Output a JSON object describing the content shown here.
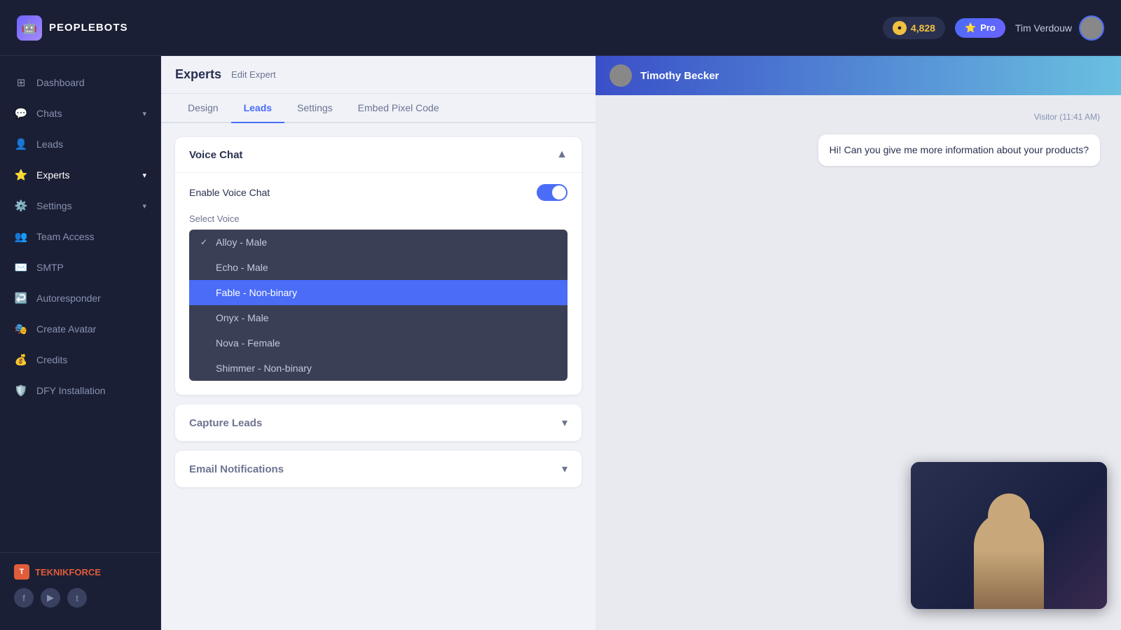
{
  "app": {
    "name": "PEOPLEBOTS",
    "logo_icon": "🤖"
  },
  "topbar": {
    "credits_label": "4,828",
    "pro_label": "Pro",
    "user_name": "Tim Verdouw",
    "coin_symbol": "●"
  },
  "sidebar": {
    "items": [
      {
        "id": "dashboard",
        "label": "Dashboard",
        "icon": "⊞",
        "has_chevron": false
      },
      {
        "id": "chats",
        "label": "Chats",
        "icon": "💬",
        "has_chevron": true
      },
      {
        "id": "leads",
        "label": "Leads",
        "icon": "👤",
        "has_chevron": false
      },
      {
        "id": "experts",
        "label": "Experts",
        "icon": "⭐",
        "has_chevron": true,
        "active": true
      },
      {
        "id": "settings",
        "label": "Settings",
        "icon": "⚙️",
        "has_chevron": true
      },
      {
        "id": "team-access",
        "label": "Team Access",
        "icon": "👥",
        "has_chevron": false
      },
      {
        "id": "smtp",
        "label": "SMTP",
        "icon": "✉️",
        "has_chevron": false
      },
      {
        "id": "autoresponder",
        "label": "Autoresponder",
        "icon": "↩️",
        "has_chevron": false
      },
      {
        "id": "create-avatar",
        "label": "Create Avatar",
        "icon": "🎭",
        "has_chevron": false
      },
      {
        "id": "credits",
        "label": "Credits",
        "icon": "💰",
        "has_chevron": false
      },
      {
        "id": "dfy-installation",
        "label": "DFY Installation",
        "icon": "🛡️",
        "has_chevron": false
      }
    ],
    "footer": {
      "brand_name": "TEKNIKFORCE",
      "social": [
        "f",
        "▶",
        "t"
      ]
    }
  },
  "header": {
    "page_title": "Experts",
    "edit_link": "Edit Expert"
  },
  "tabs": [
    {
      "id": "design",
      "label": "Design"
    },
    {
      "id": "leads",
      "label": "Leads",
      "active": true
    },
    {
      "id": "settings",
      "label": "Settings"
    },
    {
      "id": "embed-pixel-code",
      "label": "Embed Pixel Code"
    }
  ],
  "voice_chat": {
    "section_title": "Voice Chat",
    "enable_label": "Enable Voice Chat",
    "select_voice_label": "Select Voice",
    "toggle_enabled": true,
    "voices": [
      {
        "id": "alloy-male",
        "label": "Alloy - Male",
        "checked": true
      },
      {
        "id": "echo-male",
        "label": "Echo - Male",
        "checked": false
      },
      {
        "id": "fable-nonbinary",
        "label": "Fable - Non-binary",
        "checked": false,
        "highlighted": true
      },
      {
        "id": "onyx-male",
        "label": "Onyx - Male",
        "checked": false
      },
      {
        "id": "nova-female",
        "label": "Nova - Female",
        "checked": false
      },
      {
        "id": "shimmer-nonbinary",
        "label": "Shimmer - Non-binary",
        "checked": false
      }
    ]
  },
  "capture_leads": {
    "section_title": "Capture Leads"
  },
  "email_notifications": {
    "section_title": "Email Notifications"
  },
  "chat_preview": {
    "contact_name": "Timothy Becker",
    "visitor_time": "Visitor (11:41 AM)",
    "message": "Hi! Can you give me more information about your products?"
  }
}
